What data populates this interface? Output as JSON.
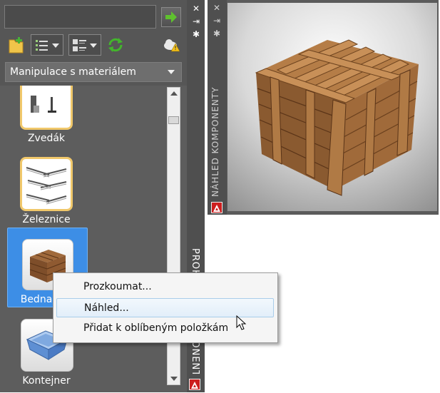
{
  "left_palette": {
    "search": {
      "value": "",
      "placeholder": ""
    },
    "category": {
      "selected": "Manipulace s materiálem"
    },
    "vertical_title": "PROHLÍŽEČ KOMPONENT",
    "items": [
      {
        "label": "Zvedák",
        "icon": "lift-thumbnail"
      },
      {
        "label": "Železnice",
        "icon": "rail-thumbnail"
      },
      {
        "label": "Bedna",
        "icon": "crate-thumbnail",
        "selected": true
      },
      {
        "label": "Kontejner",
        "icon": "container-thumbnail"
      }
    ]
  },
  "preview_panel": {
    "vertical_title": "NÁHLED KOMPONENTY",
    "model": "wooden-crate"
  },
  "context_menu": {
    "items": [
      {
        "label": "Prozkoumat..."
      },
      {
        "label": "Náhled...",
        "hover": true
      },
      {
        "label": "Přidat k oblíbeným položkám"
      }
    ]
  },
  "colors": {
    "panel_bg": "#5b5b5b",
    "selection": "#3d8ee6",
    "menu_hover": "#e2eef9",
    "accent_green": "#4caf2a",
    "brand_red": "#cc1f1f"
  }
}
